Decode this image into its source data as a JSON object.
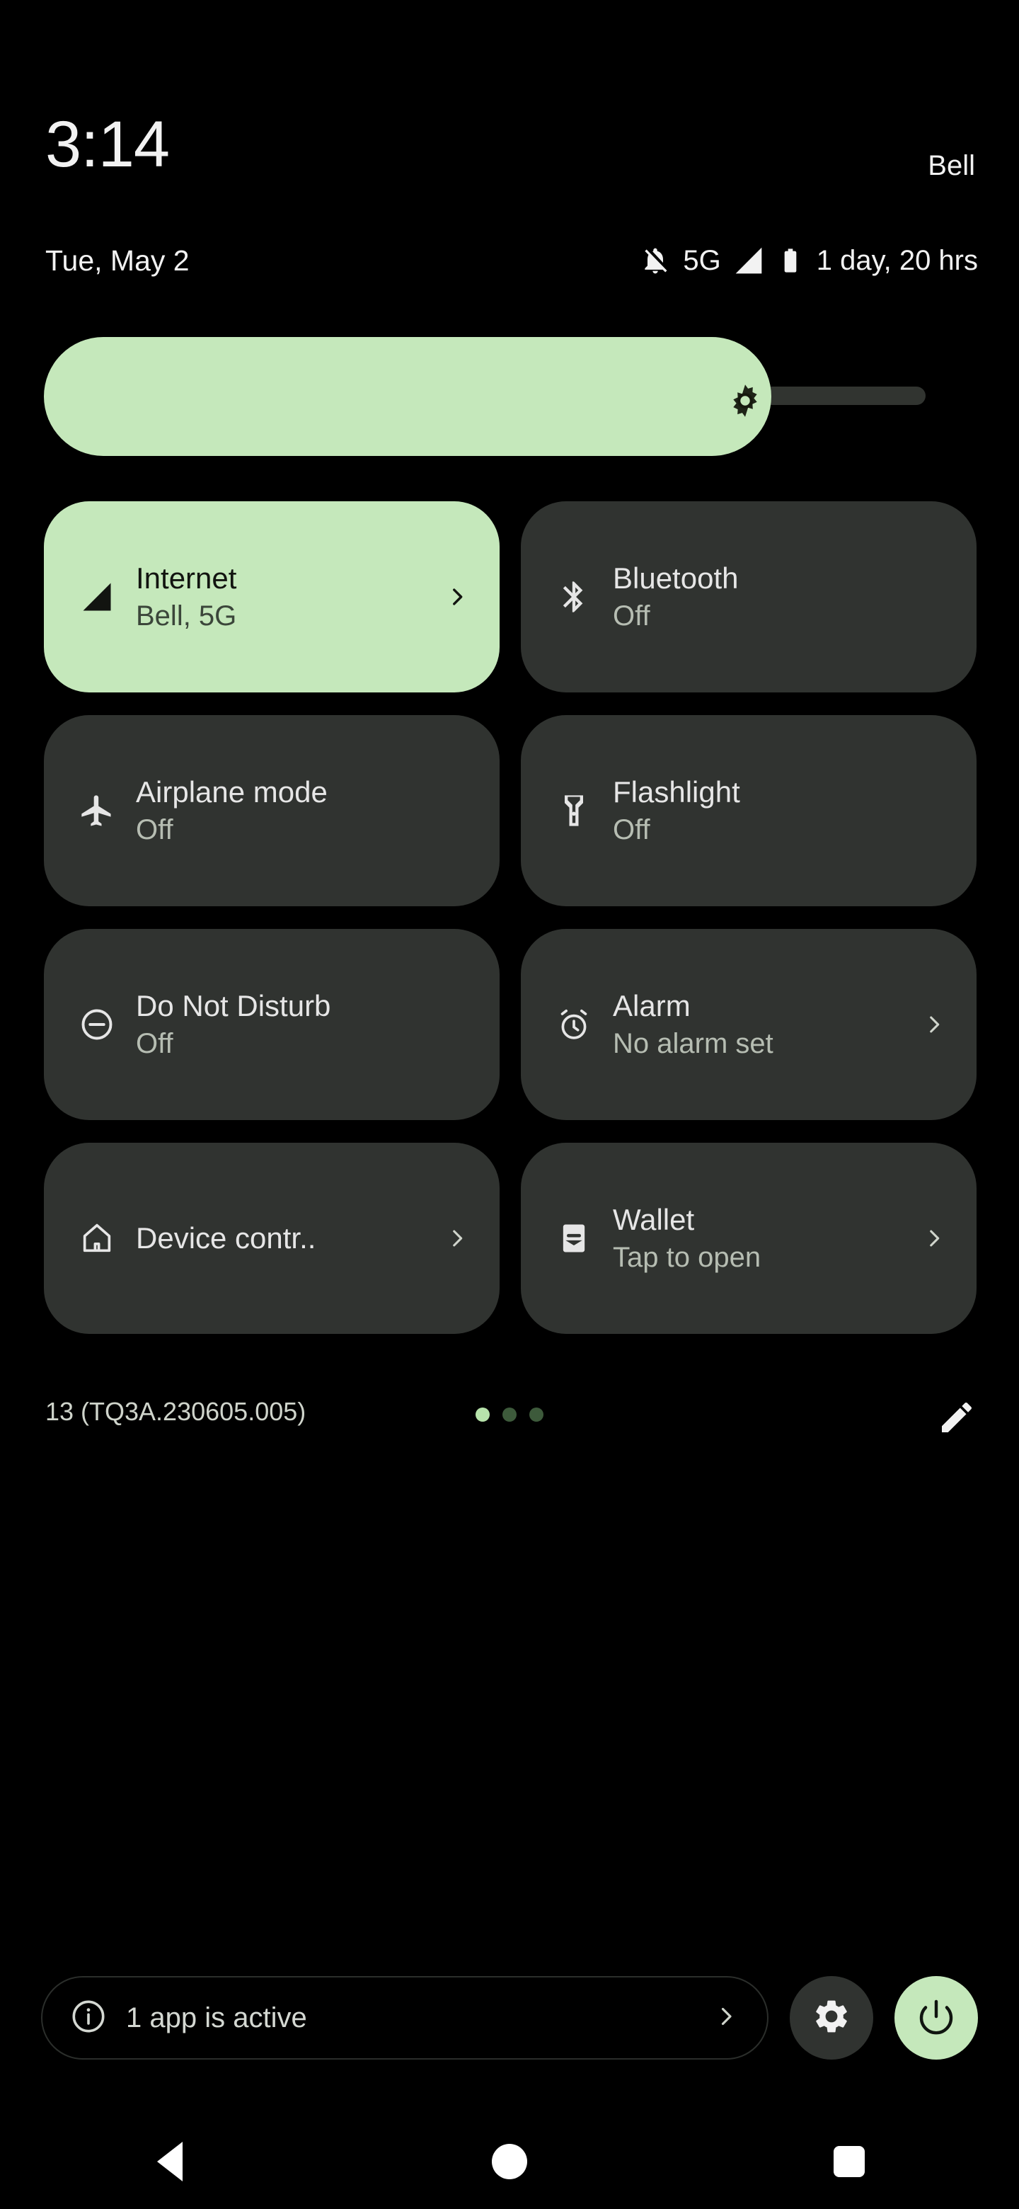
{
  "statusbar": {
    "time": "3:14",
    "date": "Tue, May 2",
    "carrier": "Bell",
    "notifications_silenced_icon": "bell-off-icon",
    "network_type": "5G",
    "signal_icon": "signal-bar-icon",
    "battery_icon": "battery-icon",
    "battery_estimate": "1 day, 20 hrs"
  },
  "brightness": {
    "label": "Brightness",
    "icon": "brightness-icon",
    "value_percent": 79
  },
  "tiles": [
    {
      "title": "Internet",
      "subtitle": "Bell, 5G",
      "icon": "signal-bar-icon",
      "active": true,
      "chevron": true,
      "single_line": false
    },
    {
      "title": "Bluetooth",
      "subtitle": "Off",
      "icon": "bluetooth-icon",
      "active": false,
      "chevron": false,
      "single_line": false
    },
    {
      "title": "Airplane mode",
      "subtitle": "Off",
      "icon": "airplane-icon",
      "active": false,
      "chevron": false,
      "single_line": false
    },
    {
      "title": "Flashlight",
      "subtitle": "Off",
      "icon": "flashlight-icon",
      "active": false,
      "chevron": false,
      "single_line": false
    },
    {
      "title": "Do Not Disturb",
      "subtitle": "Off",
      "icon": "do-not-disturb-icon",
      "active": false,
      "chevron": false,
      "single_line": false
    },
    {
      "title": "Alarm",
      "subtitle": "No alarm set",
      "icon": "alarm-clock-icon",
      "active": false,
      "chevron": true,
      "single_line": false
    },
    {
      "title": "Device contr..",
      "subtitle": "",
      "icon": "home-icon",
      "active": false,
      "chevron": true,
      "single_line": true
    },
    {
      "title": "Wallet",
      "subtitle": "Tap to open",
      "icon": "wallet-icon",
      "active": false,
      "chevron": true,
      "single_line": false
    }
  ],
  "qs_footer": {
    "build": "13 (TQ3A.230605.005)",
    "pages": 3,
    "active_page": 1,
    "edit_icon": "pencil-icon"
  },
  "bottom_bar": {
    "active_apps_label": "1 app is active",
    "info_icon": "info-icon",
    "chevron_icon": "chevron-right-icon",
    "settings_icon": "gear-icon",
    "power_icon": "power-icon"
  },
  "navbar": {
    "back": "back-button",
    "home": "home-button",
    "recents": "recents-button"
  },
  "colors": {
    "background": "#000000",
    "tile_inactive": "#303330",
    "tile_active": "#c5e8bb",
    "text_primary": "#e6e6e6",
    "text_secondary": "#b6bdb2",
    "accent": "#c5e8bb"
  }
}
